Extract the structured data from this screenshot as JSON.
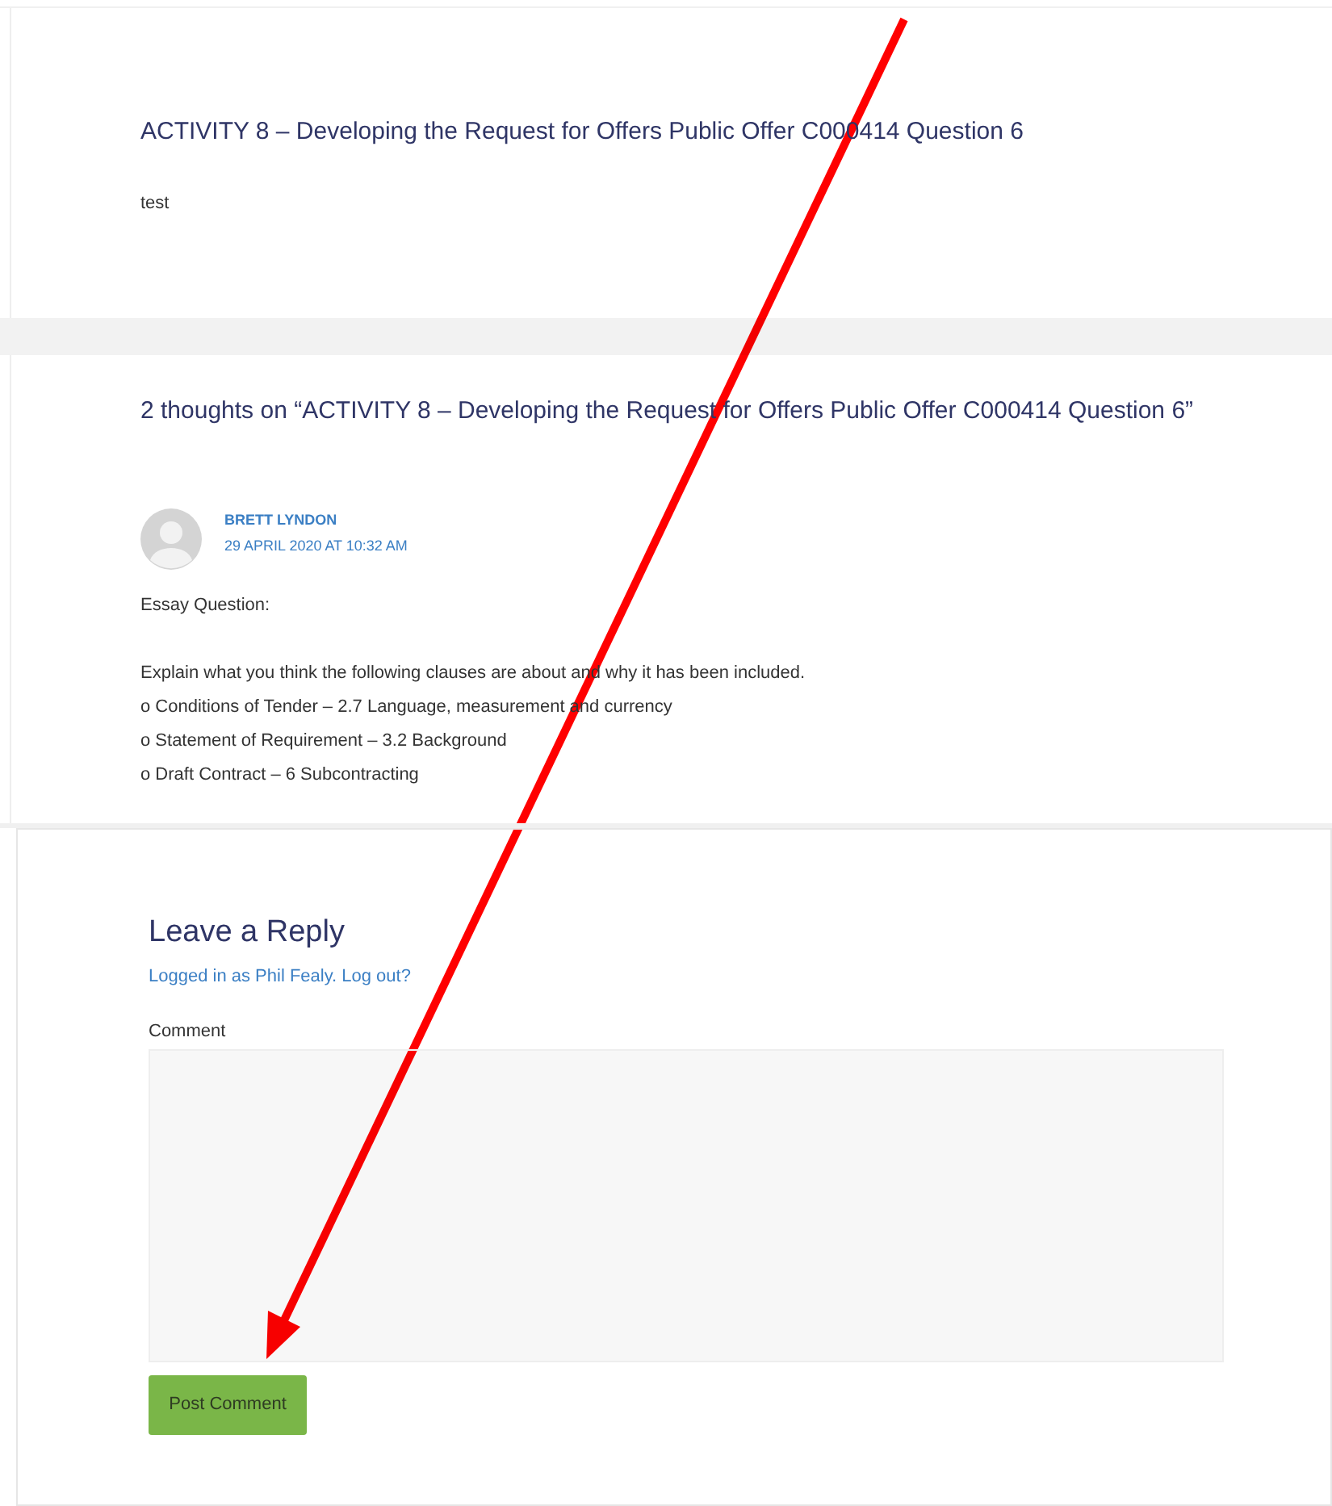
{
  "post": {
    "title": "ACTIVITY 8 – Developing the Request for Offers Public Offer C000414 Question 6",
    "body": "test"
  },
  "comments": {
    "heading": "2 thoughts on “ACTIVITY 8 – Developing the Request for Offers Public Offer C000414 Question 6”",
    "items": [
      {
        "author": "BRETT LYNDON",
        "date": "29 APRIL 2020 AT 10:32 AM",
        "paragraphs": [
          [
            "Essay Question:"
          ],
          [
            "Explain what you think the following clauses are about and why it has been included.",
            "o Conditions of Tender – 2.7 Language, measurement and currency",
            "o Statement of Requirement – 3.2 Background",
            "o Draft Contract – 6 Subcontracting"
          ]
        ]
      }
    ]
  },
  "reply": {
    "heading": "Leave a Reply",
    "logged_in": "Logged in as Phil Fealy. Log out?",
    "comment_label": "Comment",
    "submit": "Post Comment"
  }
}
